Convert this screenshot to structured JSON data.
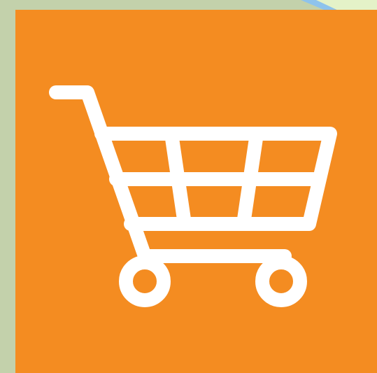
{
  "icon": {
    "name": "shopping-cart-icon",
    "tile_color": "#f48c21",
    "glyph_color": "#ffffff",
    "backdrop_color": "#c3d1ab",
    "corner_accent_color": "#8ec3ec",
    "corner_highlight_color": "#e4f2c8"
  }
}
